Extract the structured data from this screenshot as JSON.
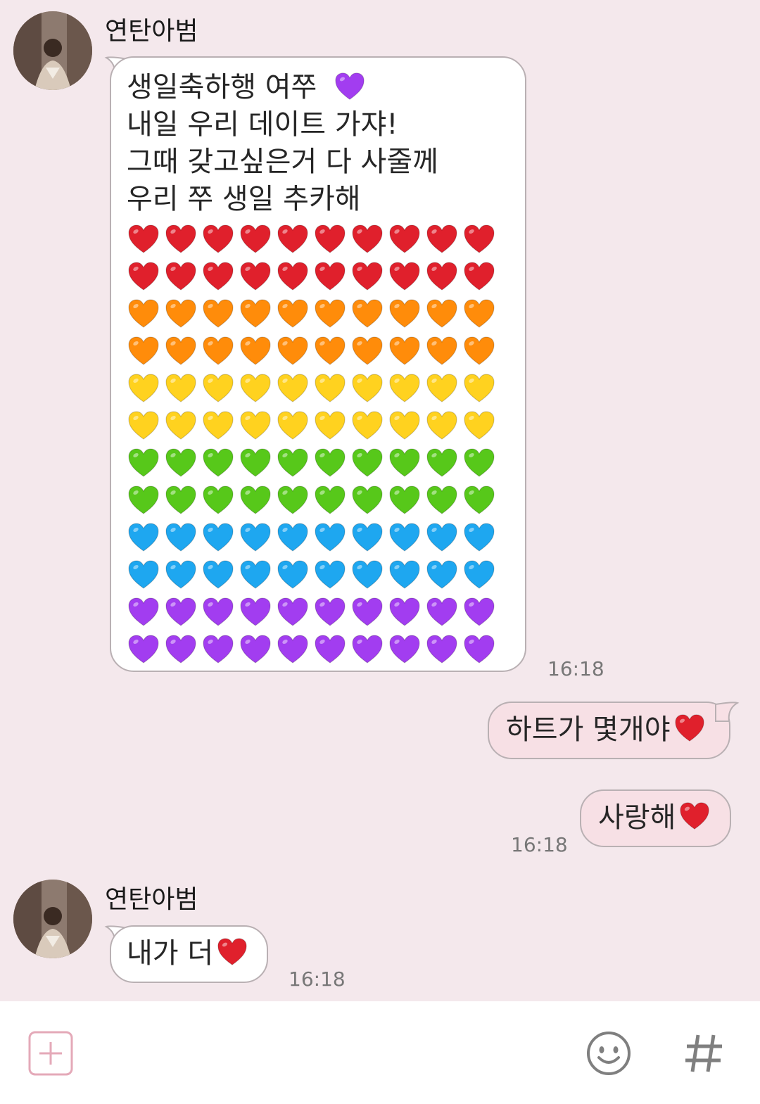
{
  "messages": [
    {
      "sender": "연탄아범",
      "text_lines": "생일축하행 여쭈\n내일 우리 데이트 가쟈!\n그때 갖고싶은거 다 사줄께\n우리 쭈 생일 추카해",
      "title_emoji": "purple-heart",
      "heart_rows": [
        "red",
        "red",
        "orange",
        "orange",
        "yellow",
        "yellow",
        "green",
        "green",
        "blue",
        "blue",
        "purple",
        "purple"
      ],
      "hearts_per_row": 10,
      "time": "16:18"
    },
    {
      "text": "하트가 몇개야",
      "emoji": "red-heart"
    },
    {
      "text": "사랑해",
      "emoji": "red-heart",
      "time": "16:18"
    },
    {
      "sender": "연탄아범",
      "text": "내가 더",
      "emoji": "red-heart",
      "time": "16:18"
    }
  ],
  "input_bar": {
    "icons": [
      "plus-icon",
      "emoji-icon",
      "hashtag-icon"
    ]
  },
  "colors": {
    "background": "#f4e8ec",
    "outgoing_bubble": "#f7e0e5",
    "incoming_bubble": "#ffffff",
    "red": "#e0202c",
    "orange": "#ff8c0a",
    "yellow": "#ffd21f",
    "green": "#57c81a",
    "blue": "#1ea7f0",
    "purple": "#a23df0"
  }
}
